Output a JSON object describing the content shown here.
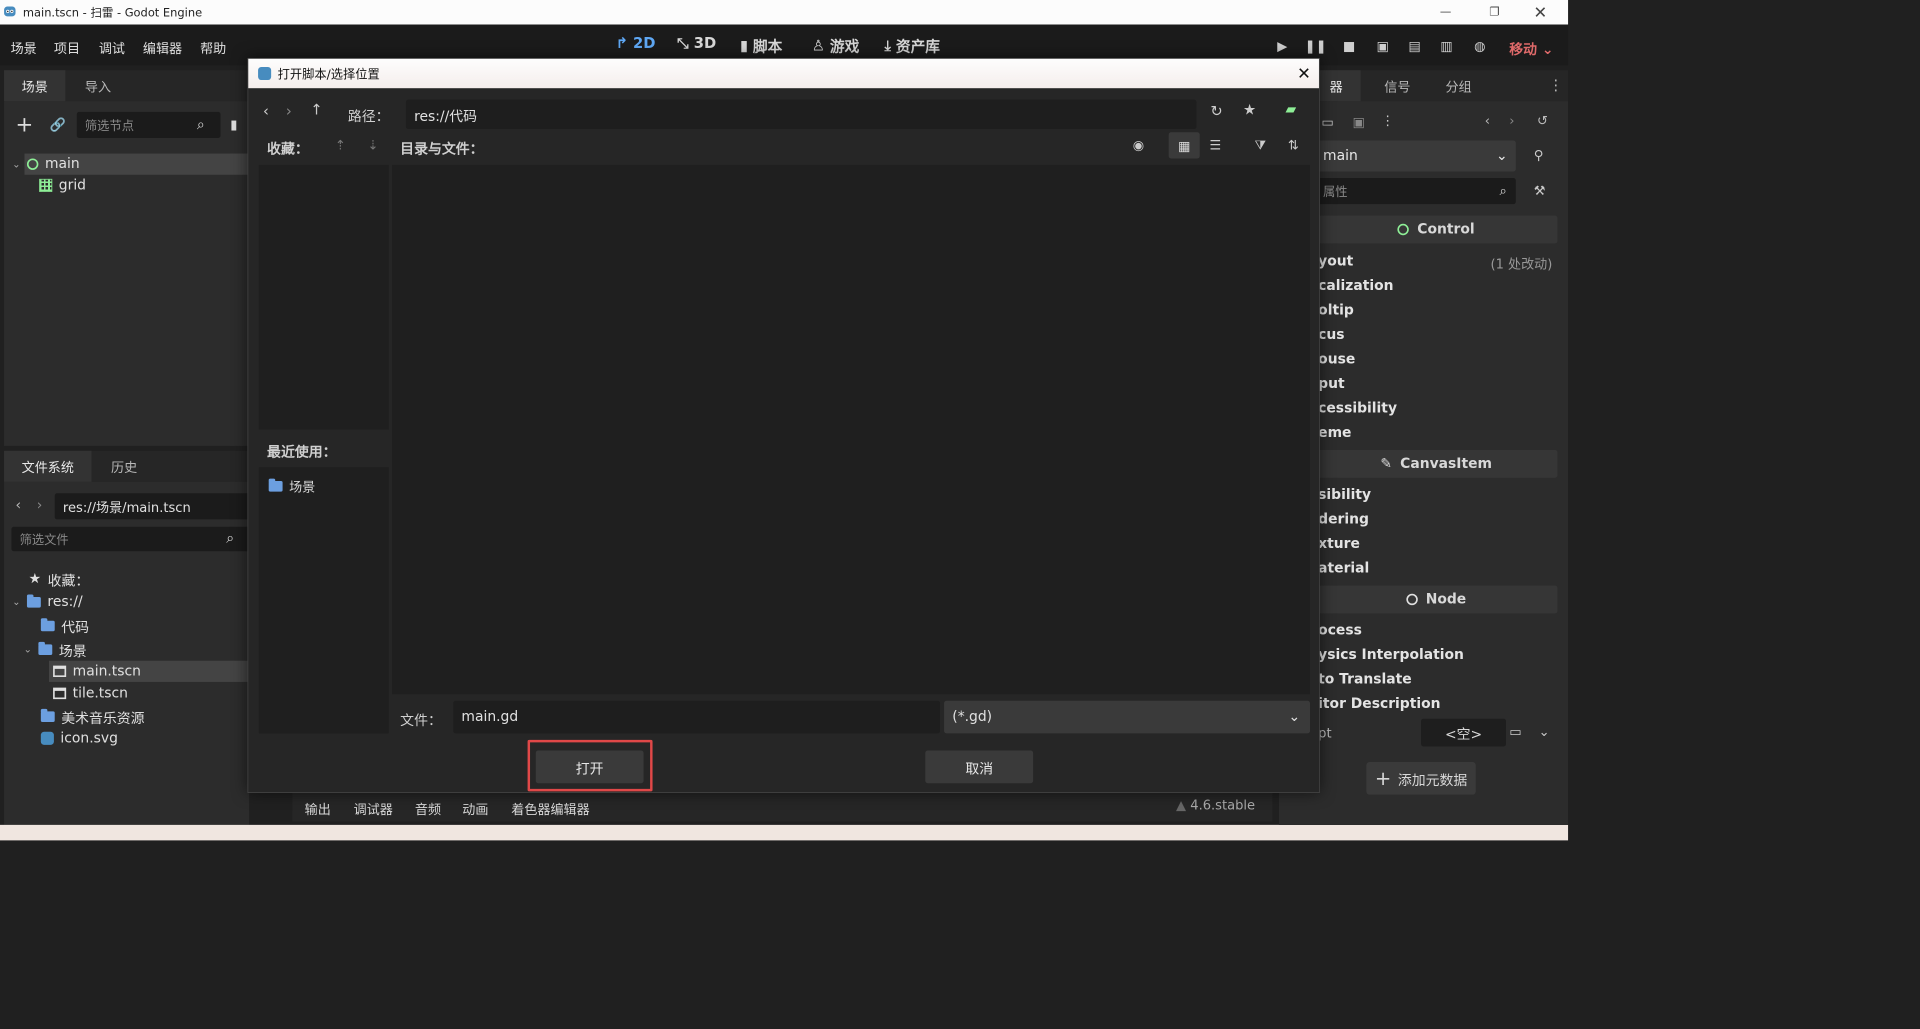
{
  "window": {
    "title": "main.tscn - 扫雷 - Godot Engine"
  },
  "menu": [
    "场景",
    "项目",
    "调试",
    "编辑器",
    "帮助"
  ],
  "workspace_tabs": [
    {
      "label": "2D",
      "active": true
    },
    {
      "label": "3D",
      "active": false
    },
    {
      "label": "脚本",
      "active": false
    },
    {
      "label": "游戏",
      "active": false
    },
    {
      "label": "资产库",
      "active": false
    }
  ],
  "renderer": "移动",
  "scene_panel": {
    "tabs": [
      "场景",
      "导入"
    ],
    "filter_placeholder": "筛选节点",
    "nodes": [
      "main",
      "grid"
    ]
  },
  "filesystem_panel": {
    "tabs": [
      "文件系统",
      "历史"
    ],
    "path": "res://场景/main.tscn",
    "filter_placeholder": "筛选文件",
    "favorites_label": "收藏：",
    "items": [
      "res://",
      "代码",
      "场景",
      "main.tscn",
      "tile.tscn",
      "美术音乐资源",
      "icon.svg"
    ]
  },
  "bottom_tabs": [
    "输出",
    "调试器",
    "音频",
    "动画",
    "着色器编辑器"
  ],
  "version": "4.6.stable",
  "inspector": {
    "tabs": [
      "器",
      "信号",
      "分组"
    ],
    "node_select": "main",
    "filter_placeholder": "属性",
    "sections": [
      "Control",
      "CanvasItem",
      "Node"
    ],
    "control_props": [
      "yout",
      "calization",
      "oltip",
      "cus",
      "ouse",
      "put",
      "cessibility",
      "eme"
    ],
    "layout_changes": "(1 处改动)",
    "canvas_props": [
      "sibility",
      "dering",
      "xture",
      "aterial"
    ],
    "node_props": [
      "ocess",
      "ysics Interpolation",
      "to Translate",
      "itor Description"
    ],
    "script_label": "pt",
    "script_value": "<空>",
    "add_meta": "添加元数据"
  },
  "dialog": {
    "title": "打开脚本/选择位置",
    "path_label": "路径：",
    "path": "res://代码",
    "favorites_label": "收藏：",
    "files_label": "目录与文件：",
    "recent_label": "最近使用：",
    "recent_items": [
      "场景"
    ],
    "file_label": "文件：",
    "file_name": "main.gd",
    "filter": "(*.gd)",
    "open": "打开",
    "cancel": "取消"
  },
  "colors": {
    "accent": "#5fa8f5",
    "highlight": "#e04848",
    "folder": "#6c9fe0",
    "green": "#8eef97"
  }
}
